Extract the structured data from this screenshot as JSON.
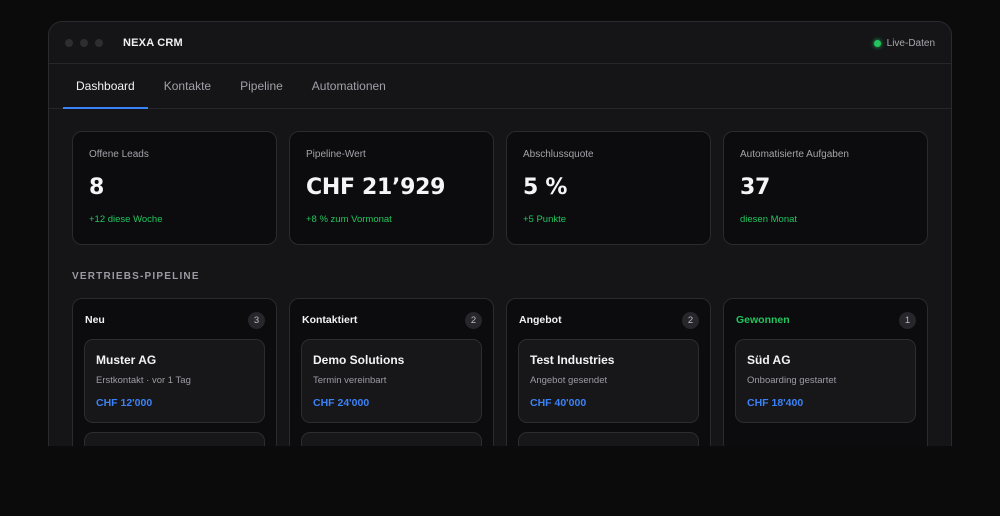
{
  "app": {
    "title": "NEXA CRM",
    "live_label": "Live-Daten"
  },
  "tabs": [
    {
      "label": "Dashboard",
      "active": true
    },
    {
      "label": "Kontakte",
      "active": false
    },
    {
      "label": "Pipeline",
      "active": false
    },
    {
      "label": "Automationen",
      "active": false
    }
  ],
  "stats": [
    {
      "label": "Offene Leads",
      "value": "8",
      "delta": "+12 diese Woche"
    },
    {
      "label": "Pipeline-Wert",
      "value": "CHF 21’929",
      "delta": "+8 % zum Vormonat"
    },
    {
      "label": "Abschlussquote",
      "value": "5 %",
      "delta": "+5 Punkte"
    },
    {
      "label": "Automatisierte Aufgaben",
      "value": "37",
      "delta": "diesen Monat"
    }
  ],
  "pipeline": {
    "title": "VERTRIEBS-PIPELINE",
    "columns": [
      {
        "name": "Neu",
        "count": "3",
        "cards": [
          {
            "name": "Muster AG",
            "sub": "Erstkontakt · vor 1 Tag",
            "amount": "CHF 12'000"
          }
        ]
      },
      {
        "name": "Kontaktiert",
        "count": "2",
        "cards": [
          {
            "name": "Demo Solutions",
            "sub": "Termin vereinbart",
            "amount": "CHF 24'000"
          }
        ]
      },
      {
        "name": "Angebot",
        "count": "2",
        "cards": [
          {
            "name": "Test Industries",
            "sub": "Angebot gesendet",
            "amount": "CHF 40'000"
          }
        ]
      },
      {
        "name": "Gewonnen",
        "count": "1",
        "cards": [
          {
            "name": "Süd AG",
            "sub": "Onboarding gestartet",
            "amount": "CHF 18'400"
          }
        ]
      }
    ]
  },
  "colors": {
    "accent": "#3b82f6",
    "positive": "#22c55e",
    "background": "#0b0b0c",
    "panel": "#151518"
  }
}
